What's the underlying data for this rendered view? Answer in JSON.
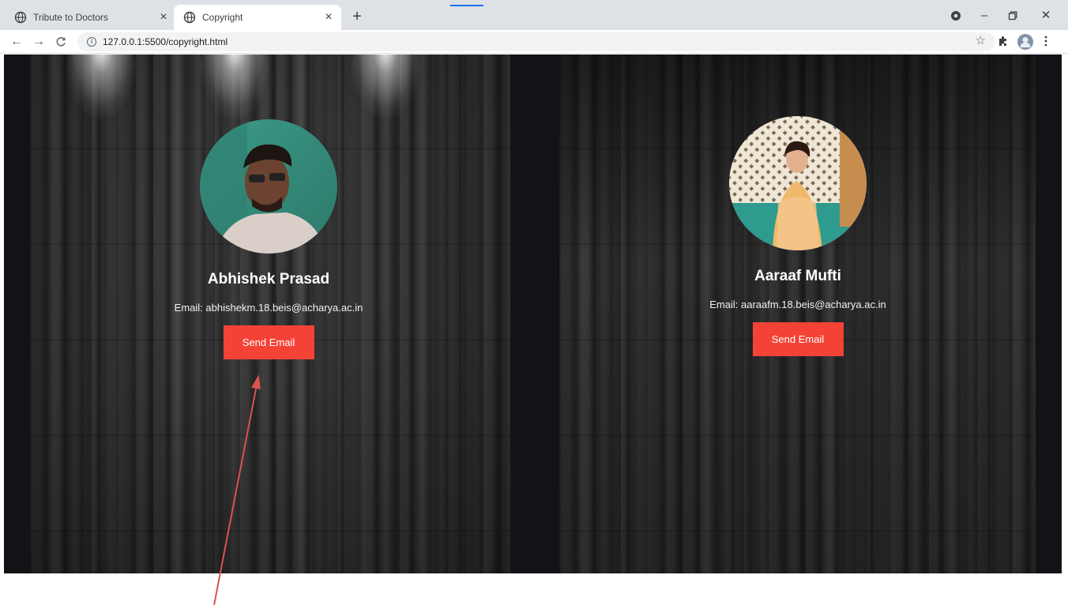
{
  "tabs": [
    {
      "title": "Tribute to Doctors",
      "active": false
    },
    {
      "title": "Copyright",
      "active": true
    }
  ],
  "address_bar": {
    "url": "127.0.0.1:5500/copyright.html"
  },
  "profiles": [
    {
      "name": "Abhishek Prasad",
      "email": "Email: abhishekm.18.beis@acharya.ac.in",
      "button": "Send Email"
    },
    {
      "name": "Aaraaf Mufti",
      "email": "Email: aaraafm.18.beis@acharya.ac.in",
      "button": "Send Email"
    }
  ],
  "colors": {
    "button": "#f44336",
    "tabstrip": "#dee1e6",
    "page_background": "#121316",
    "annotation_arrow": "#d9534f"
  },
  "icons": [
    "globe-icon",
    "close-icon",
    "plus-icon",
    "record-icon",
    "minimize-icon",
    "restore-icon",
    "back-arrow-icon",
    "forward-arrow-icon",
    "reload-icon",
    "info-icon",
    "star-icon",
    "puzzle-icon",
    "avatar-icon",
    "kebab-menu-icon"
  ]
}
